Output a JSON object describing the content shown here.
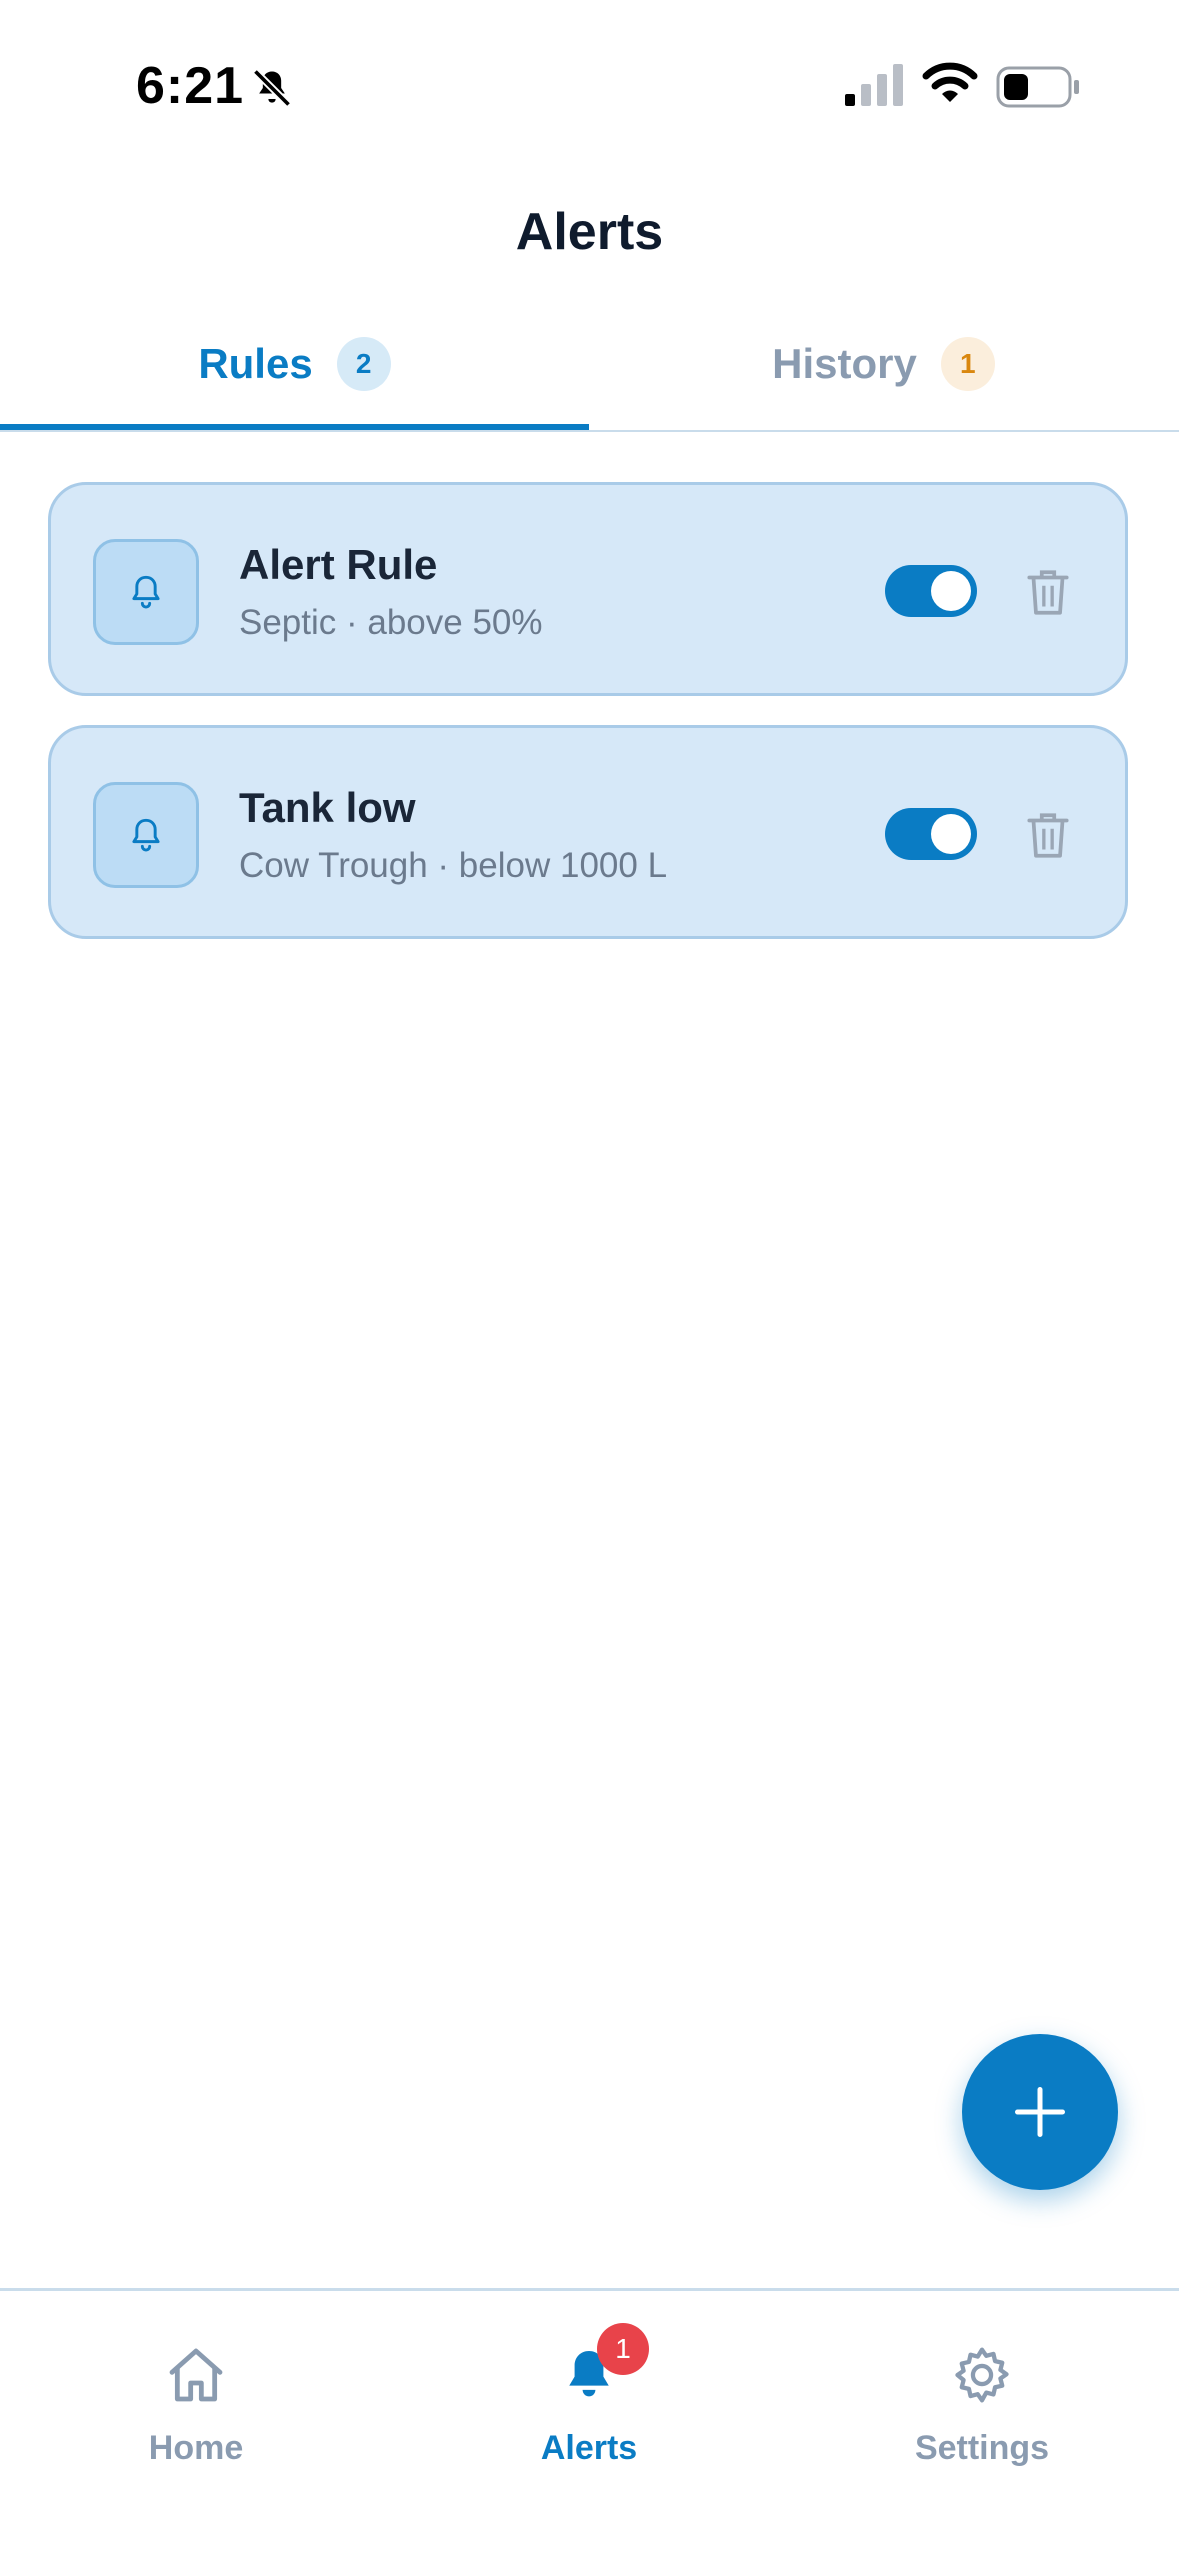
{
  "status_bar": {
    "time": "6:21",
    "icons": [
      "bell-slash-icon",
      "cellular-signal-icon",
      "wifi-icon",
      "battery-icon"
    ]
  },
  "header": {
    "title": "Alerts"
  },
  "tabs": [
    {
      "label": "Rules",
      "badge": "2",
      "active": true
    },
    {
      "label": "History",
      "badge": "1",
      "active": false
    }
  ],
  "rules": [
    {
      "title": "Alert Rule",
      "subtitle": "Septic · above 50%",
      "enabled": true,
      "icon": "bell-icon"
    },
    {
      "title": "Tank low",
      "subtitle": "Cow Trough · below 1000 L",
      "enabled": true,
      "icon": "bell-icon"
    }
  ],
  "fab": {
    "icon": "plus-icon"
  },
  "bottom_nav": {
    "items": [
      {
        "label": "Home",
        "icon": "home-icon",
        "active": false
      },
      {
        "label": "Alerts",
        "icon": "bell-icon",
        "active": true,
        "badge": "1"
      },
      {
        "label": "Settings",
        "icon": "gear-icon",
        "active": false
      }
    ]
  },
  "colors": {
    "accent": "#0a7cc4",
    "card_background": "#d6e8f8",
    "muted_text": "#8a9bb0",
    "history_badge": "#d9870f",
    "notification_badge": "#e8434a"
  }
}
